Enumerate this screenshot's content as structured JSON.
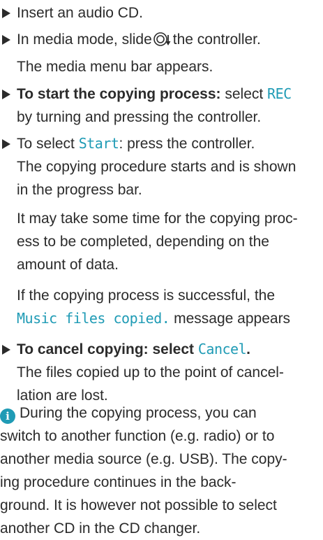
{
  "steps": [
    {
      "lines": [
        "Insert an audio CD."
      ]
    },
    {
      "line1_before": "In media mode, slide",
      "line1_after": "the controller.",
      "line2": "The media menu bar appears."
    },
    {
      "bold": "To start the copying process:",
      "text_before_ui": "select",
      "ui": "REC",
      "line2": "by turning and pressing the controller."
    },
    {
      "text_before_ui": "To select",
      "ui": "Start",
      "text_after_ui": ": press the controller.",
      "lines": [
        "The copying procedure starts and is shown",
        "in the progress bar."
      ],
      "para1": [
        "It may take some time for the copying proc-",
        "ess to be completed, depending on the",
        "amount of data."
      ],
      "para2_line1": "If the copying process is successful, the",
      "para2_ui": "Music files copied.",
      "para2_after": "message appears"
    },
    {
      "bold": "To cancel copying: select",
      "ui": "Cancel",
      "punct": ".",
      "lines": [
        "The files copied up to the point of cancel-",
        "lation are lost."
      ]
    }
  ],
  "note": {
    "icon": "info-icon",
    "lines": [
      "During the copying process, you can",
      "switch to another function (e.g. radio) or to",
      "another media source (e.g. USB). The copy-",
      "ing procedure continues in the back-",
      "ground. It is however not possible to select",
      "another CD in the CD changer."
    ]
  },
  "colors": {
    "text": "#2b2b2b",
    "accent": "#1f9bb5"
  }
}
